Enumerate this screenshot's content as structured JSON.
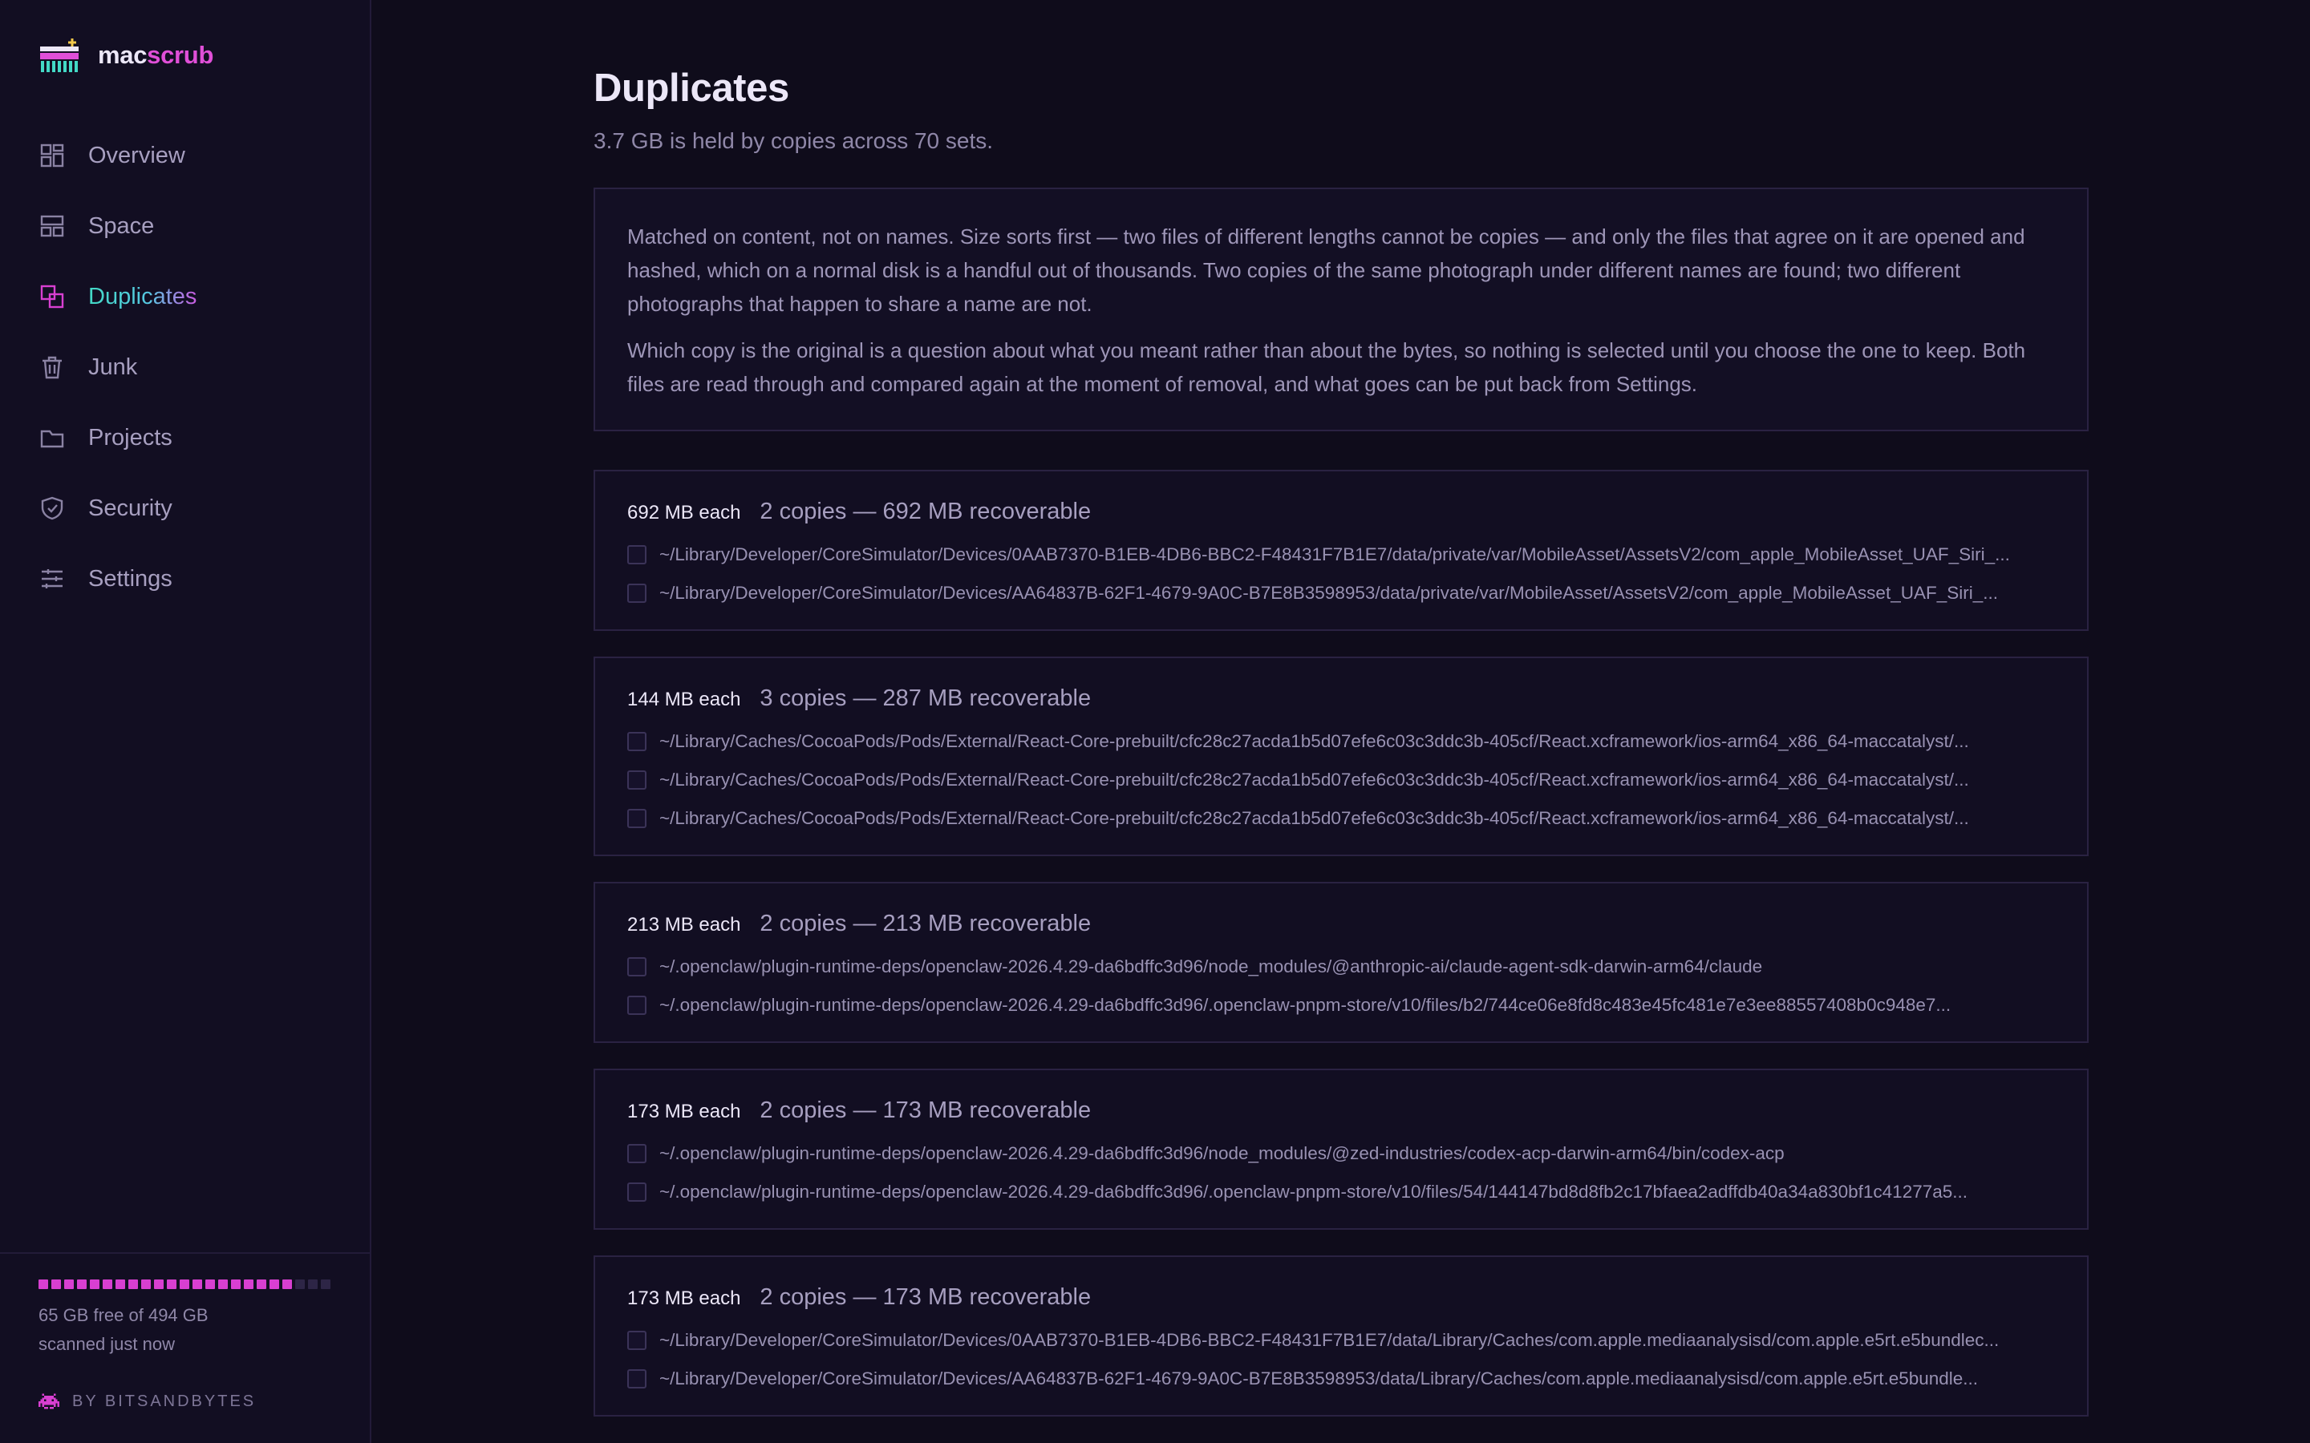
{
  "app": {
    "name_prefix": "mac",
    "name_suffix": "scrub",
    "accent": "#e04fd8",
    "active_gradient": [
      "#43d9c6",
      "#c95be0"
    ]
  },
  "sidebar": {
    "items": [
      {
        "label": "Overview",
        "icon": "overview-grid-icon",
        "active": false
      },
      {
        "label": "Space",
        "icon": "space-layout-icon",
        "active": false
      },
      {
        "label": "Duplicates",
        "icon": "duplicates-icon",
        "active": true
      },
      {
        "label": "Junk",
        "icon": "trash-icon",
        "active": false
      },
      {
        "label": "Projects",
        "icon": "folder-icon",
        "active": false
      },
      {
        "label": "Security",
        "icon": "shield-icon",
        "active": false
      },
      {
        "label": "Settings",
        "icon": "sliders-icon",
        "active": false
      }
    ],
    "disk": {
      "used_fraction": 0.87,
      "free_text": "65 GB free of 494 GB",
      "scan_text": "scanned just now"
    },
    "credit": "BY BITSANDBYTES"
  },
  "main": {
    "title": "Duplicates",
    "subtitle": "3.7 GB is held by copies across 70 sets.",
    "info": {
      "p1": "Matched on content, not on names. Size sorts first — two files of different lengths cannot be copies — and only the files that agree on it are opened and hashed, which on a normal disk is a handful out of thousands. Two copies of the same photograph under different names are found; two different photographs that happen to share a name are not.",
      "p2": "Which copy is the original is a question about what you meant rather than about the bytes, so nothing is selected until you choose the one to keep. Both files are read through and compared again at the moment of removal, and what goes can be put back from Settings."
    },
    "sets": [
      {
        "size": "692 MB each",
        "summary": "2 copies — 692 MB recoverable",
        "files": [
          "~/Library/Developer/CoreSimulator/Devices/0AAB7370-B1EB-4DB6-BBC2-F48431F7B1E7/data/private/var/MobileAsset/AssetsV2/com_apple_MobileAsset_UAF_Siri_...",
          "~/Library/Developer/CoreSimulator/Devices/AA64837B-62F1-4679-9A0C-B7E8B3598953/data/private/var/MobileAsset/AssetsV2/com_apple_MobileAsset_UAF_Siri_..."
        ]
      },
      {
        "size": "144 MB each",
        "summary": "3 copies — 287 MB recoverable",
        "files": [
          "~/Library/Caches/CocoaPods/Pods/External/React-Core-prebuilt/cfc28c27acda1b5d07efe6c03c3ddc3b-405cf/React.xcframework/ios-arm64_x86_64-maccatalyst/...",
          "~/Library/Caches/CocoaPods/Pods/External/React-Core-prebuilt/cfc28c27acda1b5d07efe6c03c3ddc3b-405cf/React.xcframework/ios-arm64_x86_64-maccatalyst/...",
          "~/Library/Caches/CocoaPods/Pods/External/React-Core-prebuilt/cfc28c27acda1b5d07efe6c03c3ddc3b-405cf/React.xcframework/ios-arm64_x86_64-maccatalyst/..."
        ]
      },
      {
        "size": "213 MB each",
        "summary": "2 copies — 213 MB recoverable",
        "files": [
          "~/.openclaw/plugin-runtime-deps/openclaw-2026.4.29-da6bdffc3d96/node_modules/@anthropic-ai/claude-agent-sdk-darwin-arm64/claude",
          "~/.openclaw/plugin-runtime-deps/openclaw-2026.4.29-da6bdffc3d96/.openclaw-pnpm-store/v10/files/b2/744ce06e8fd8c483e45fc481e7e3ee88557408b0c948e7..."
        ]
      },
      {
        "size": "173 MB each",
        "summary": "2 copies — 173 MB recoverable",
        "files": [
          "~/.openclaw/plugin-runtime-deps/openclaw-2026.4.29-da6bdffc3d96/node_modules/@zed-industries/codex-acp-darwin-arm64/bin/codex-acp",
          "~/.openclaw/plugin-runtime-deps/openclaw-2026.4.29-da6bdffc3d96/.openclaw-pnpm-store/v10/files/54/144147bd8d8fb2c17bfaea2adffdb40a34a830bf1c41277a5..."
        ]
      },
      {
        "size": "173 MB each",
        "summary": "2 copies — 173 MB recoverable",
        "files": [
          "~/Library/Developer/CoreSimulator/Devices/0AAB7370-B1EB-4DB6-BBC2-F48431F7B1E7/data/Library/Caches/com.apple.mediaanalysisd/com.apple.e5rt.e5bundlec...",
          "~/Library/Developer/CoreSimulator/Devices/AA64837B-62F1-4679-9A0C-B7E8B3598953/data/Library/Caches/com.apple.mediaanalysisd/com.apple.e5rt.e5bundle..."
        ]
      }
    ]
  }
}
